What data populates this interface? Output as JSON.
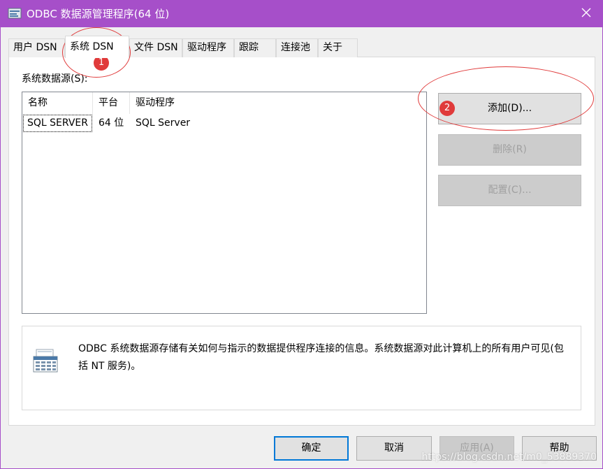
{
  "window": {
    "title": "ODBC 数据源管理程序(64 位)",
    "accent_color": "#a64fc9",
    "icon": "odbc-app-icon",
    "close_icon": "close-icon"
  },
  "tabs": [
    {
      "label": "用户 DSN",
      "active": false
    },
    {
      "label": "系统 DSN",
      "active": true
    },
    {
      "label": "文件 DSN",
      "active": false
    },
    {
      "label": "驱动程序",
      "active": false
    },
    {
      "label": "跟踪",
      "active": false
    },
    {
      "label": "连接池",
      "active": false
    },
    {
      "label": "关于",
      "active": false
    }
  ],
  "system_dsn": {
    "section_label": "系统数据源(S):",
    "columns": [
      "名称",
      "平台",
      "驱动程序"
    ],
    "rows": [
      {
        "name": "SQL SERVER",
        "platform": "64 位",
        "driver": "SQL Server"
      }
    ]
  },
  "side_buttons": {
    "add": "添加(D)...",
    "remove": "删除(R)",
    "configure": "配置(C)..."
  },
  "info": {
    "icon": "data-source-icon",
    "text": "ODBC 系统数据源存储有关如何与指示的数据提供程序连接的信息。系统数据源对此计算机上的所有用户可见(包括 NT 服务)。"
  },
  "footer_buttons": {
    "ok": "确定",
    "cancel": "取消",
    "apply": "应用(A)",
    "help": "帮助"
  },
  "annotations": {
    "marker1": "1",
    "marker2": "2",
    "color": "#e03a3a"
  },
  "watermark": "https://blog.csdn.net/m0_53889370"
}
